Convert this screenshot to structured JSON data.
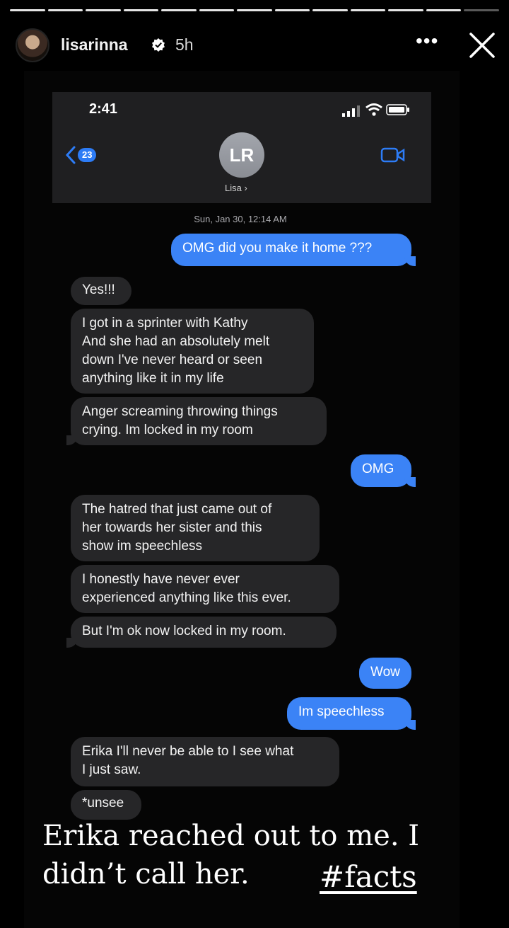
{
  "story": {
    "progress_segments": 13,
    "progress_completed": 12,
    "username": "lisarinna",
    "time_ago": "5h",
    "more_icon": "more-horizontal-icon",
    "close_icon": "close-icon",
    "verified_icon": "verified-badge-icon"
  },
  "phone": {
    "status_time": "2:41",
    "back_badge": "23",
    "contact_initials": "LR",
    "contact_name": "Lisa ›",
    "timestamp": "Sun, Jan 30, 12:14 AM"
  },
  "messages": [
    {
      "dir": "out",
      "text": "OMG did you make it home ???"
    },
    {
      "dir": "in",
      "text": "Yes!!!"
    },
    {
      "dir": "in",
      "text": "I got in a sprinter with Kathy\nAnd she had an absolutely melt\ndown I've never heard or seen\nanything like it in my life"
    },
    {
      "dir": "in",
      "text": "Anger screaming throwing things\ncrying. Im locked in my room"
    },
    {
      "dir": "out",
      "text": "OMG"
    },
    {
      "dir": "in",
      "text": "The hatred that just came out of\nher towards her sister and this\nshow im speechless"
    },
    {
      "dir": "in",
      "text": "I honestly have never ever\nexperienced anything like this ever."
    },
    {
      "dir": "in",
      "text": "But I'm ok now locked in my room."
    },
    {
      "dir": "out",
      "text": "Wow"
    },
    {
      "dir": "out",
      "text": "Im speechless"
    },
    {
      "dir": "in",
      "text": "Erika I'll never be able to I see what\nI just saw."
    },
    {
      "dir": "in",
      "text": "*unsee"
    }
  ],
  "caption": {
    "text": "Erika reached out to me. I didn’t call her.",
    "hashtag": "#facts"
  },
  "colors": {
    "outgoing_bubble": "#3b83f6",
    "incoming_bubble": "#262628",
    "badge": "#2d7cf6"
  }
}
